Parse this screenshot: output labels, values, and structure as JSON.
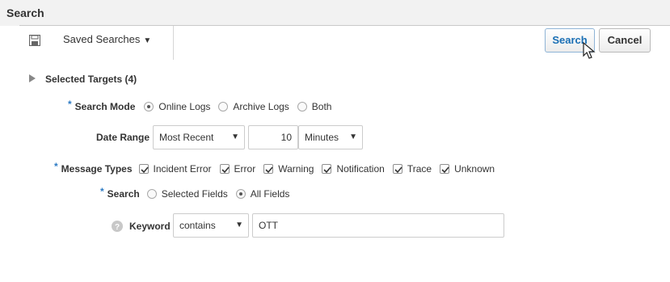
{
  "header": {
    "title": "Search"
  },
  "toolbar": {
    "saved_searches_label": "Saved Searches",
    "search_button": "Search",
    "cancel_button": "Cancel"
  },
  "targets": {
    "label": "Selected Targets (4)"
  },
  "search_mode": {
    "required_mark": "*",
    "label": "Search Mode",
    "options": [
      "Online Logs",
      "Archive Logs",
      "Both"
    ],
    "selected": "Online Logs"
  },
  "date_range": {
    "label": "Date Range",
    "range_value": "Most Recent",
    "amount": "10",
    "unit": "Minutes"
  },
  "message_types": {
    "required_mark": "*",
    "label": "Message Types",
    "options": [
      "Incident Error",
      "Error",
      "Warning",
      "Notification",
      "Trace",
      "Unknown"
    ]
  },
  "search_scope": {
    "required_mark": "*",
    "label": "Search",
    "options": [
      "Selected Fields",
      "All Fields"
    ],
    "selected": "All Fields"
  },
  "keyword": {
    "label": "Keyword",
    "operator": "contains",
    "value": "OTT"
  },
  "colors": {
    "accent": "#1a6fb5",
    "required": "#2d7bc4",
    "header_bg": "#f2f2f2"
  },
  "icons": [
    "save-icon",
    "caret-down-icon",
    "expand-triangle-icon",
    "help-icon",
    "cursor-icon"
  ]
}
